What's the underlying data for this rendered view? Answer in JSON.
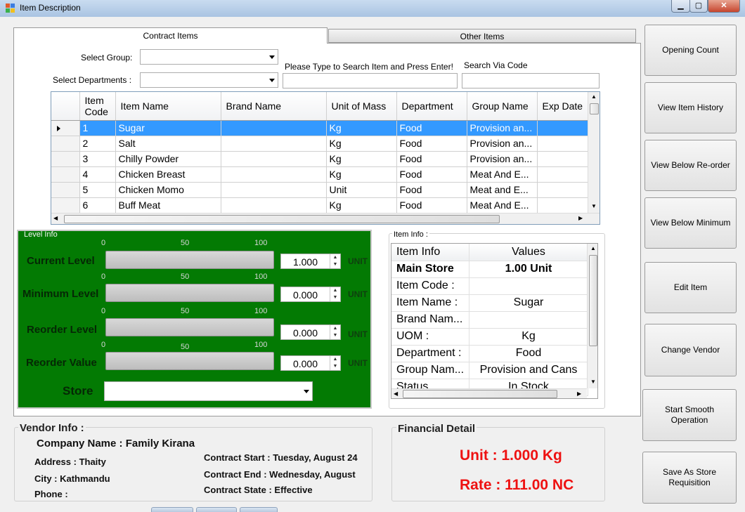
{
  "window": {
    "title": "Item Description"
  },
  "tabs": [
    {
      "label": "Contract Items",
      "active": true
    },
    {
      "label": "Other Items",
      "active": false
    }
  ],
  "filters": {
    "select_group_label": "Select Group:",
    "select_departments_label": "Select Departments :",
    "search_label": "Please Type to Search Item and Press Enter!",
    "search_code_label": "Search Via Code",
    "group_value": "",
    "department_value": "",
    "search_value": "",
    "code_value": ""
  },
  "items_grid": {
    "columns": [
      "Item Code",
      "Item Name",
      "Brand Name",
      "Unit of Mass",
      "Department",
      "Group Name",
      "Exp Date"
    ],
    "rows": [
      {
        "code": "1",
        "name": "Sugar",
        "brand": "",
        "unit": "Kg",
        "dept": "Food",
        "group": "Provision an...",
        "exp": ""
      },
      {
        "code": "2",
        "name": "Salt",
        "brand": "",
        "unit": "Kg",
        "dept": "Food",
        "group": "Provision an...",
        "exp": ""
      },
      {
        "code": "3",
        "name": "Chilly Powder",
        "brand": "",
        "unit": "Kg",
        "dept": "Food",
        "group": "Provision an...",
        "exp": ""
      },
      {
        "code": "4",
        "name": "Chicken Breast",
        "brand": "",
        "unit": "Kg",
        "dept": "Food",
        "group": "Meat And E...",
        "exp": ""
      },
      {
        "code": "5",
        "name": "Chicken Momo",
        "brand": "",
        "unit": "Unit",
        "dept": "Food",
        "group": "Meat and E...",
        "exp": ""
      },
      {
        "code": "6",
        "name": "Buff Meat",
        "brand": "",
        "unit": "Kg",
        "dept": "Food",
        "group": "Meat And E...",
        "exp": ""
      }
    ],
    "selected_row": 0
  },
  "level_info": {
    "legend": "Level Info",
    "ruler": {
      "min": "0",
      "mid": "50",
      "max": "100"
    },
    "unit_label": "UNIT",
    "rows": [
      {
        "label": "Current Level",
        "value": "1.000"
      },
      {
        "label": "Minimum Level",
        "value": "0.000"
      },
      {
        "label": "Reorder Level",
        "value": "0.000"
      },
      {
        "label": "Reorder Value",
        "value": "0.000"
      }
    ],
    "store_label": "Store",
    "store_value": ""
  },
  "item_info": {
    "legend": "Item Info :",
    "header": [
      "Item Info",
      "Values"
    ],
    "rows": [
      {
        "key": "Main Store",
        "value": "1.00 Unit",
        "bold": true
      },
      {
        "key": "Item Code :",
        "value": ""
      },
      {
        "key": "Item Name :",
        "value": "Sugar"
      },
      {
        "key": "Brand Nam...",
        "value": ""
      },
      {
        "key": "UOM :",
        "value": "Kg"
      },
      {
        "key": "Department :",
        "value": "Food"
      },
      {
        "key": "Group Nam...",
        "value": "Provision and Cans"
      },
      {
        "key": "Status",
        "value": "In Stock"
      }
    ]
  },
  "side_buttons": [
    "Opening Count",
    "View Item History",
    "View Below Re-order",
    "View Below Minimum",
    "Edit Item",
    "Change Vendor",
    "Start Smooth Operation",
    "Save As Store Requisition"
  ],
  "vendor": {
    "title": "Vendor Info :",
    "company": "Company Name : Family Kirana",
    "address": "Address : Thaity",
    "city": "City : Kathmandu",
    "phone": "Phone :",
    "contract_start": "Contract Start : Tuesday, August 24",
    "contract_end": "Contract End : Wednesday, August",
    "contract_state": "Contract State : Effective"
  },
  "financial": {
    "title": "Financial Detail",
    "unit": "Unit : 1.000 Kg",
    "rate": "Rate : 111.00 NC",
    "accent": "#ee1111"
  },
  "colors": {
    "level_panel": "#037a03",
    "selection": "#3399ff"
  }
}
